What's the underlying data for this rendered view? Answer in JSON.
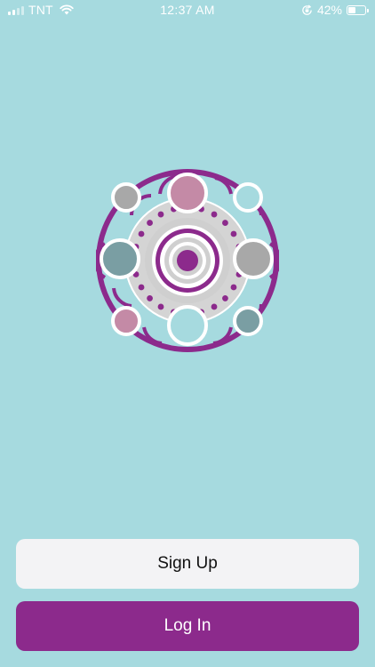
{
  "status_bar": {
    "carrier": "TNT",
    "time": "12:37 AM",
    "battery_percent": "42%",
    "battery_level": 0.42,
    "icons": [
      "signal-icon",
      "wifi-icon",
      "orientation-lock-icon",
      "battery-icon"
    ]
  },
  "logo": {
    "icon": "mandala-logo",
    "colors": {
      "ring": "#8c2a8c",
      "gray": "#a8a8a8",
      "rose": "#c48aa6",
      "teal": "#7a9ea3",
      "light_teal": "#a6dadf"
    }
  },
  "buttons": {
    "signup_label": "Sign Up",
    "login_label": "Log In"
  },
  "colors": {
    "background": "#a6dadf",
    "primary": "#8c2a8c",
    "secondary_button": "#f3f3f5"
  }
}
